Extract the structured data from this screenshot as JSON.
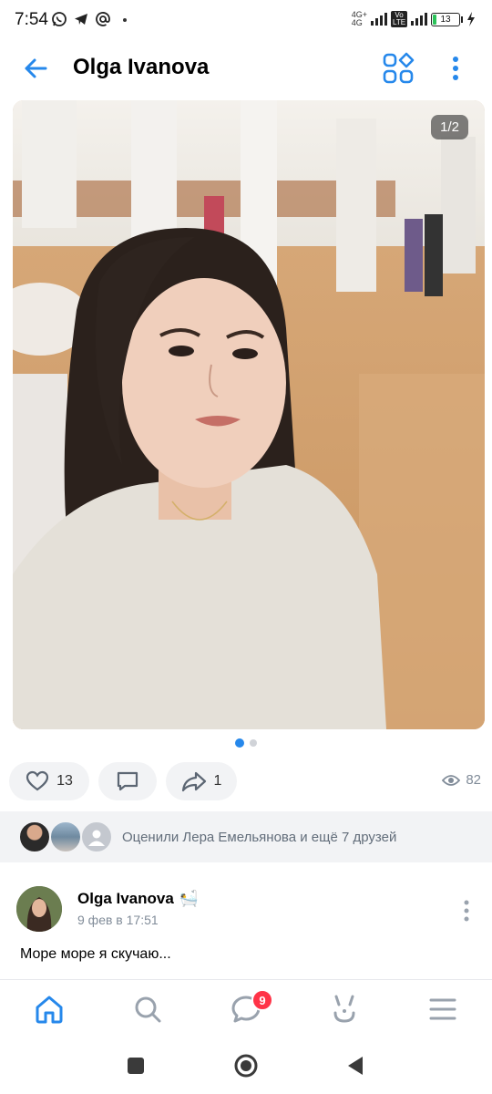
{
  "status_bar": {
    "time": "7:54",
    "network_top": "4G+",
    "network_bottom": "4G",
    "volte": "Vo LTE",
    "battery": "13",
    "battery_level": 0.13,
    "battery_color": "#2cc35a"
  },
  "header": {
    "title": "Olga Ivanova",
    "back_icon": "arrow-left-icon",
    "grid_icon": "apps-grid-icon",
    "more_icon": "more-vertical-icon"
  },
  "photo": {
    "counter": "1/2",
    "pages": 2,
    "current_page": 1
  },
  "actions": {
    "likes": "13",
    "shares": "1",
    "views": "82"
  },
  "likers": {
    "text": "Оценили Лера Емельянова и ещё 7 друзей"
  },
  "post": {
    "author": "Olga Ivanova",
    "author_emoji": "🛀",
    "date": "9 фев в 17:51",
    "text": "Море море я скучаю..."
  },
  "tab_bar": {
    "items": [
      "home-icon",
      "search-icon",
      "messages-icon",
      "clips-icon",
      "menu-icon"
    ],
    "messages_badge": "9"
  },
  "colors": {
    "accent": "#2688eb",
    "badge": "#ff3347",
    "secondary_text": "#818c99"
  }
}
